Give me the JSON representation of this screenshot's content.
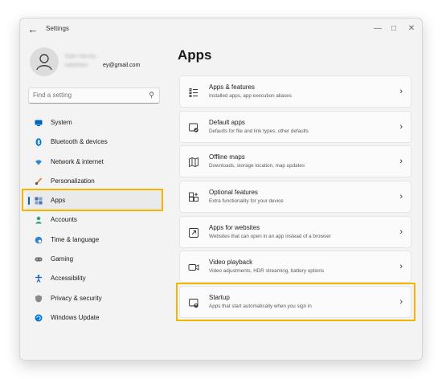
{
  "window": {
    "title": "Settings",
    "back_icon": "arrow-left-icon",
    "controls": [
      "minimize-icon",
      "maximize-icon",
      "close-icon"
    ]
  },
  "profile": {
    "name_blurred": "Kate Harvey",
    "email_blurred": "katieharv",
    "email_visible": "ey@gmail.com"
  },
  "search": {
    "placeholder": "Find a setting",
    "icon": "search-icon"
  },
  "sidebar": {
    "items": [
      {
        "label": "System",
        "icon": "monitor-icon",
        "color": "#0067c0"
      },
      {
        "label": "Bluetooth & devices",
        "icon": "bluetooth-icon",
        "color": "#0078d4"
      },
      {
        "label": "Network & internet",
        "icon": "wifi-icon",
        "color": "#2b88d8"
      },
      {
        "label": "Personalization",
        "icon": "paintbrush-icon",
        "color": "#d47a2a"
      },
      {
        "label": "Apps",
        "icon": "apps-icon",
        "color": "#4a6fa5",
        "selected": true
      },
      {
        "label": "Accounts",
        "icon": "person-icon",
        "color": "#26a269"
      },
      {
        "label": "Time & language",
        "icon": "globe-clock-icon",
        "color": "#2b88d8"
      },
      {
        "label": "Gaming",
        "icon": "gamepad-icon",
        "color": "#6b6b6b"
      },
      {
        "label": "Accessibility",
        "icon": "accessibility-icon",
        "color": "#1565c0"
      },
      {
        "label": "Privacy & security",
        "icon": "shield-icon",
        "color": "#7a7a7a"
      },
      {
        "label": "Windows Update",
        "icon": "update-icon",
        "color": "#0078d4"
      }
    ]
  },
  "main": {
    "heading": "Apps",
    "cards": [
      {
        "title": "Apps & features",
        "subtitle": "Installed apps, app execution aliases",
        "icon": "list-icon"
      },
      {
        "title": "Default apps",
        "subtitle": "Defaults for file and link types, other defaults",
        "icon": "default-apps-icon"
      },
      {
        "title": "Offline maps",
        "subtitle": "Downloads, storage location, map updates",
        "icon": "map-icon"
      },
      {
        "title": "Optional features",
        "subtitle": "Extra functionality for your device",
        "icon": "add-grid-icon"
      },
      {
        "title": "Apps for websites",
        "subtitle": "Websites that can open in an app instead of a browser",
        "icon": "open-external-icon"
      },
      {
        "title": "Video playback",
        "subtitle": "Video adjustments, HDR streaming, battery options",
        "icon": "video-icon"
      },
      {
        "title": "Startup",
        "subtitle": "Apps that start automatically when you sign in",
        "icon": "startup-icon"
      }
    ]
  },
  "highlight_color": "#f5b400",
  "accent_color": "#005fb8"
}
